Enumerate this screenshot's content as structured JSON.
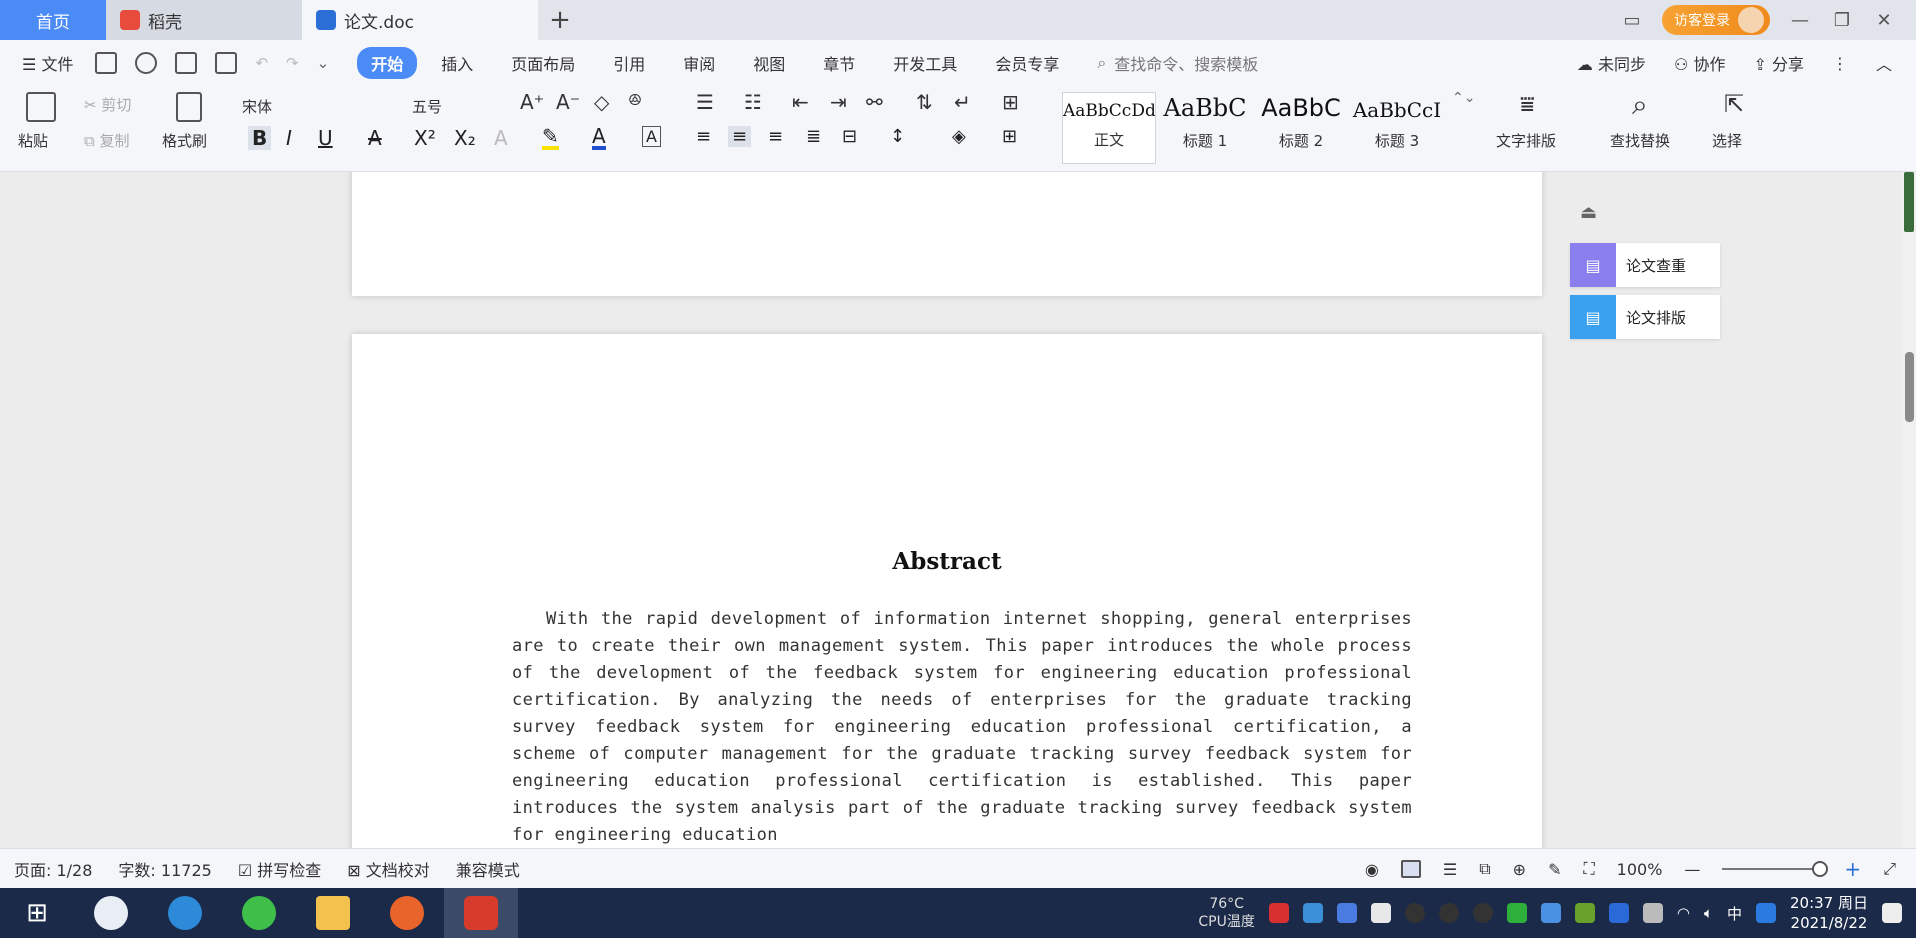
{
  "tabs": {
    "home": "首页",
    "docer": "稻壳",
    "document": "论文.doc"
  },
  "titlebar": {
    "vip_label": "访客登录"
  },
  "menu": {
    "file": "文件",
    "items": [
      "开始",
      "插入",
      "页面布局",
      "引用",
      "审阅",
      "视图",
      "章节",
      "开发工具",
      "会员专享"
    ],
    "search_placeholder": "查找命令、搜索模板",
    "sync": "未同步",
    "collab": "协作",
    "share": "分享"
  },
  "ribbon": {
    "paste": "粘贴",
    "cut": "剪切",
    "copy": "复制",
    "format_painter": "格式刷",
    "font_name": "宋体",
    "font_size": "五号",
    "styles": [
      {
        "sample": "AaBbCcDd",
        "name": "正文"
      },
      {
        "sample": "AaBbC",
        "name": "标题 1"
      },
      {
        "sample": "AaBbC",
        "name": "标题 2"
      },
      {
        "sample": "AaBbCcI",
        "name": "标题 3"
      }
    ],
    "text_layout": "文字排版",
    "find_replace": "查找替换",
    "select": "选择"
  },
  "document": {
    "abstract_title": "Abstract",
    "abstract_body": "With the rapid development of information internet shopping, general enterprises are to create their own management system. This paper introduces the whole process of the development of the feedback system for engineering education professional certification. By analyzing the needs of enterprises for the graduate tracking survey feedback system for engineering education professional certification, a scheme of computer management for the graduate tracking survey feedback system for engineering education professional certification is established. This paper introduces the system analysis part of the graduate tracking survey feedback system for engineering education"
  },
  "side_panel": {
    "check": "论文查重",
    "layout": "论文排版"
  },
  "status": {
    "page": "页面: 1/28",
    "words": "字数: 11725",
    "spell_check": "拼写检查",
    "doc_proof": "文档校对",
    "compat_mode": "兼容模式",
    "zoom": "100%"
  },
  "taskbar": {
    "cpu_temp": "76°C",
    "cpu_label": "CPU温度",
    "ime": "中",
    "time": "20:37 周日",
    "date": "2021/8/22"
  },
  "colors": {
    "accent": "#4a8bf5",
    "taskbar": "#1b2a48",
    "vip": "#f08a1c"
  }
}
